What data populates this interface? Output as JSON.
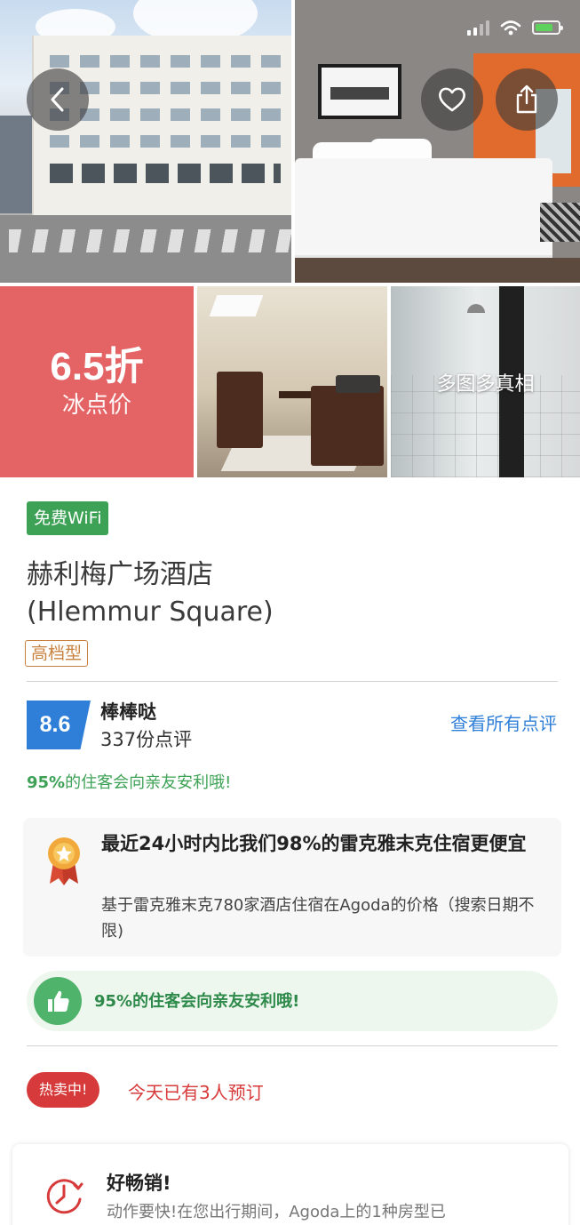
{
  "status_bar": {
    "battery_level": 0.8,
    "battery_color": "#5ed25c"
  },
  "gallery": {
    "discount": {
      "value": "6.5折",
      "caption": "冰点价"
    },
    "more_photos_label": "多图多真相"
  },
  "icons": {
    "back": "chevron-left-icon",
    "favorite": "heart-icon",
    "share": "share-icon",
    "medal": "medal-icon",
    "thumbs_up": "thumbs-up-icon",
    "clock": "clock-icon"
  },
  "hotel": {
    "wifi_badge": "免费WiFi",
    "name_cn": "赫利梅广场酒店",
    "name_en": "(Hlemmur Square)",
    "class_badge": "高档型"
  },
  "rating": {
    "score": "8.6",
    "word": "棒棒哒",
    "review_count": "337份点评",
    "all_reviews_link": "查看所有点评",
    "recommend_pct": "95%",
    "recommend_rest": "的住客会向亲友安利哦!"
  },
  "price_card": {
    "title": "最近24小时内比我们98%的雷克雅末克住宿更便宜",
    "description": "基于雷克雅末克780家酒店住宿在Agoda的价格（搜索日期不限)"
  },
  "recommend_pill": {
    "text": "95%的住客会向亲友安利哦!"
  },
  "hot": {
    "badge": "热卖中!",
    "booked": "今天已有3人预订"
  },
  "selling_card": {
    "title": "好畅销!",
    "description": "动作要快!在您出行期间，Agoda上的1种房型已"
  },
  "colors": {
    "discount_bg": "#e46466",
    "wifi_green": "#3da256",
    "score_blue": "#2f7fd9",
    "hot_red": "#d73a3a",
    "class_orange": "#c8813f"
  }
}
